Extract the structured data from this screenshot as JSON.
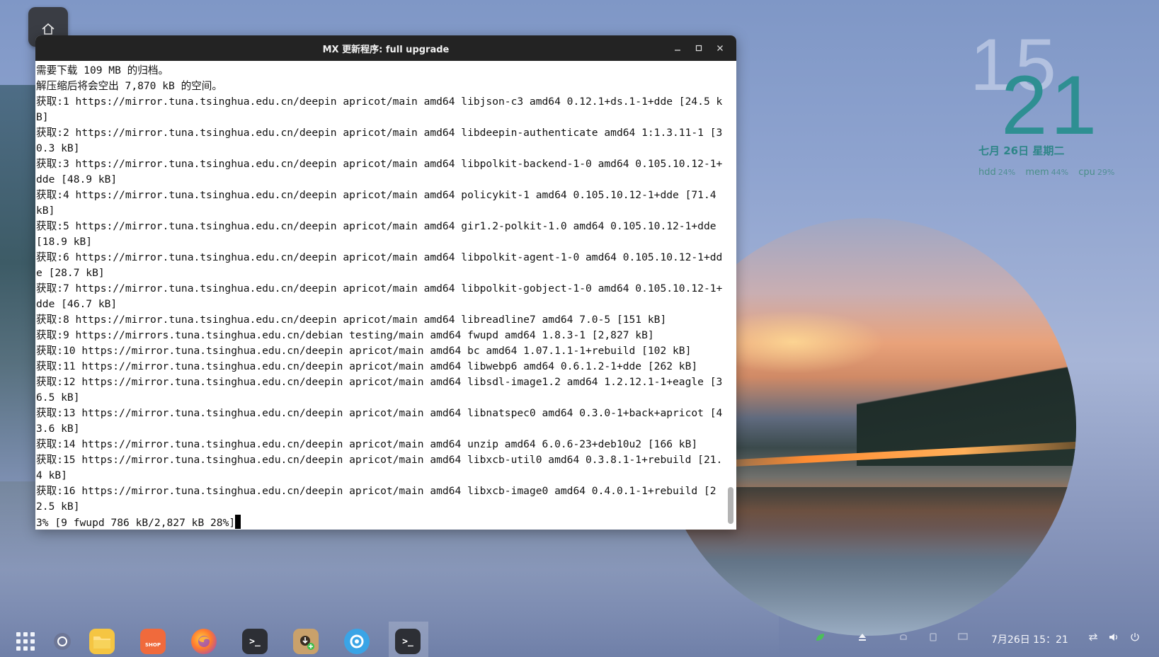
{
  "window": {
    "title": "MX 更新程序: full upgrade"
  },
  "terminal": {
    "lines": [
      "需要下载 109 MB 的归档。",
      "解压缩后将会空出 7,870 kB 的空间。",
      "获取:1 https://mirror.tuna.tsinghua.edu.cn/deepin apricot/main amd64 libjson-c3 amd64 0.12.1+ds.1-1+dde [24.5 kB]",
      "获取:2 https://mirror.tuna.tsinghua.edu.cn/deepin apricot/main amd64 libdeepin-authenticate amd64 1:1.3.11-1 [30.3 kB]",
      "获取:3 https://mirror.tuna.tsinghua.edu.cn/deepin apricot/main amd64 libpolkit-backend-1-0 amd64 0.105.10.12-1+dde [48.9 kB]",
      "获取:4 https://mirror.tuna.tsinghua.edu.cn/deepin apricot/main amd64 policykit-1 amd64 0.105.10.12-1+dde [71.4 kB]",
      "获取:5 https://mirror.tuna.tsinghua.edu.cn/deepin apricot/main amd64 gir1.2-polkit-1.0 amd64 0.105.10.12-1+dde [18.9 kB]",
      "获取:6 https://mirror.tuna.tsinghua.edu.cn/deepin apricot/main amd64 libpolkit-agent-1-0 amd64 0.105.10.12-1+dde [28.7 kB]",
      "获取:7 https://mirror.tuna.tsinghua.edu.cn/deepin apricot/main amd64 libpolkit-gobject-1-0 amd64 0.105.10.12-1+dde [46.7 kB]",
      "获取:8 https://mirror.tuna.tsinghua.edu.cn/deepin apricot/main amd64 libreadline7 amd64 7.0-5 [151 kB]",
      "获取:9 https://mirrors.tuna.tsinghua.edu.cn/debian testing/main amd64 fwupd amd64 1.8.3-1 [2,827 kB]",
      "获取:10 https://mirror.tuna.tsinghua.edu.cn/deepin apricot/main amd64 bc amd64 1.07.1.1-1+rebuild [102 kB]",
      "获取:11 https://mirror.tuna.tsinghua.edu.cn/deepin apricot/main amd64 libwebp6 amd64 0.6.1.2-1+dde [262 kB]",
      "获取:12 https://mirror.tuna.tsinghua.edu.cn/deepin apricot/main amd64 libsdl-image1.2 amd64 1.2.12.1-1+eagle [36.5 kB]",
      "获取:13 https://mirror.tuna.tsinghua.edu.cn/deepin apricot/main amd64 libnatspec0 amd64 0.3.0-1+back+apricot [43.6 kB]",
      "获取:14 https://mirror.tuna.tsinghua.edu.cn/deepin apricot/main amd64 unzip amd64 6.0.6-23+deb10u2 [166 kB]",
      "获取:15 https://mirror.tuna.tsinghua.edu.cn/deepin apricot/main amd64 libxcb-util0 amd64 0.3.8.1-1+rebuild [21.4 kB]",
      "获取:16 https://mirror.tuna.tsinghua.edu.cn/deepin apricot/main amd64 libxcb-image0 amd64 0.4.0.1-1+rebuild [22.5 kB]"
    ],
    "progress_line": "3% [9 fwupd 786 kB/2,827 kB 28%]"
  },
  "clock_widget": {
    "hour": "15",
    "minute": "21",
    "date": "七月 26日 星期二",
    "stats": [
      {
        "label": "hdd",
        "value": "24%"
      },
      {
        "label": "mem",
        "value": "44%"
      },
      {
        "label": "cpu",
        "value": "29%"
      }
    ]
  },
  "taskbar": {
    "datetime": "7月26日  15：21",
    "shop_label": "SHOP",
    "items": [
      "launcher-icon",
      "multitask-view-icon",
      "file-manager-icon",
      "app-store-icon",
      "firefox-icon",
      "terminal-icon",
      "package-installer-icon",
      "browser-icon",
      "terminal-active-icon"
    ]
  },
  "colors": {
    "titlebar": "#232323",
    "clock_accent": "#2e8f92",
    "terminal_bg": "#ffffff"
  }
}
